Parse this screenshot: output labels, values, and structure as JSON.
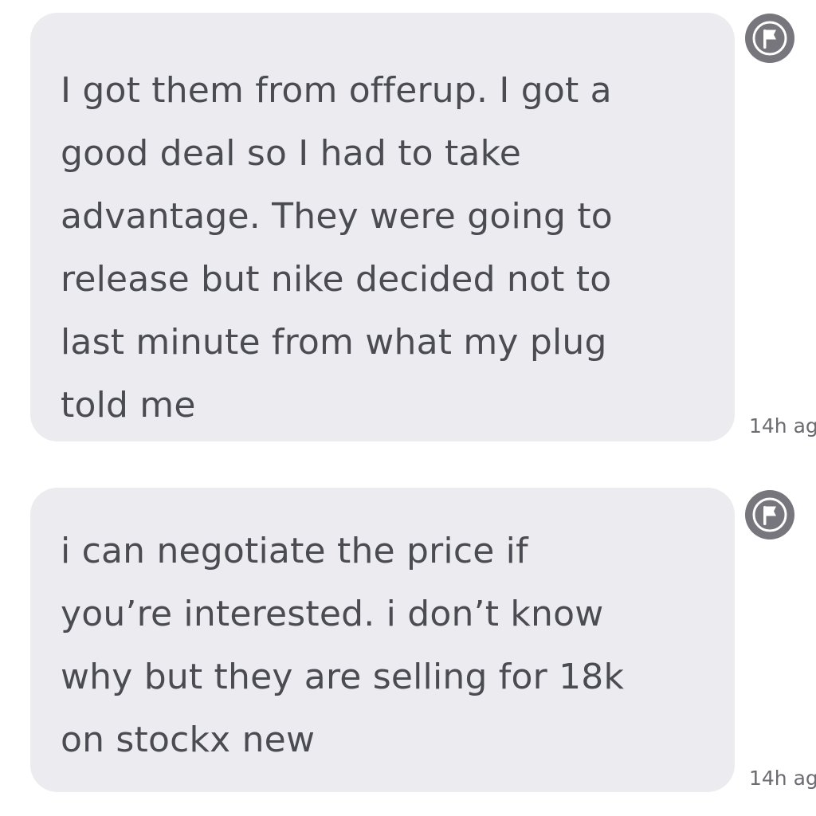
{
  "messages": [
    {
      "text": "I got them from offerup. I got a\ngood deal so I had to take\nadvantage. They were going to\nrelease but nike decided not to\nlast minute from what my plug\ntold me",
      "timestamp": "14h ag"
    },
    {
      "text": "i can negotiate the price if\nyou’re interested. i don’t know\nwhy but they are selling for 18k\non stockx new",
      "timestamp": "14h ag"
    }
  ],
  "colors": {
    "bubble": "#ececf0",
    "text": "#4b4b52",
    "flag_circle": "#76767c"
  },
  "icons": {
    "report": "flag-icon"
  }
}
